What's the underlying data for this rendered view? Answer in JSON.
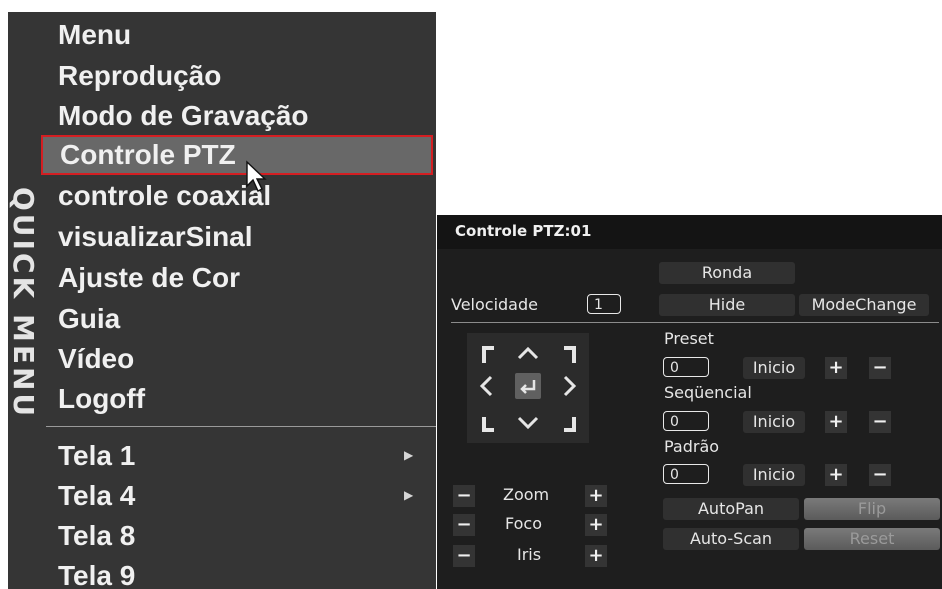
{
  "quick_menu": {
    "vertical_title": "QUICK MENU",
    "items": [
      {
        "label": "Menu"
      },
      {
        "label": "Reprodução"
      },
      {
        "label": "Modo de Gravação"
      },
      {
        "label": "Controle PTZ",
        "selected": true
      },
      {
        "label": "controle coaxial"
      },
      {
        "label": "visualizarSinal"
      },
      {
        "label": "Ajuste de Cor"
      },
      {
        "label": "Guia"
      },
      {
        "label": "Vídeo"
      },
      {
        "label": "Logoff"
      }
    ],
    "screen_items": [
      {
        "label": "Tela 1",
        "submenu": true
      },
      {
        "label": "Tela 4",
        "submenu": true
      },
      {
        "label": "Tela 8",
        "submenu": false
      },
      {
        "label": "Tela 9",
        "submenu": false
      }
    ]
  },
  "ptz": {
    "title": "Controle PTZ:01",
    "speed_label": "Velocidade",
    "speed_value": "1",
    "ronda_label": "Ronda",
    "hide_label": "Hide",
    "modechange_label": "ModeChange",
    "preset_label": "Preset",
    "preset_value": "0",
    "sequencial_label": "Seqüencial",
    "sequencial_value": "0",
    "padrao_label": "Padrão",
    "padrao_value": "0",
    "inicio_label": "Inicio",
    "plus": "+",
    "minus": "−",
    "zoom_label": "Zoom",
    "foco_label": "Foco",
    "iris_label": "Iris",
    "autopan_label": "AutoPan",
    "flip_label": "Flip",
    "autoscan_label": "Auto-Scan",
    "reset_label": "Reset"
  },
  "colors": {
    "menu_bg": "#353535",
    "selection_border": "#d41e22",
    "panel_bg": "#1e1e1e"
  }
}
